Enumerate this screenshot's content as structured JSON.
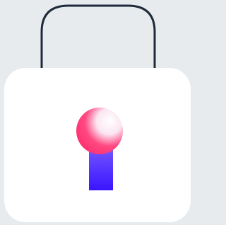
{
  "illustration": {
    "icon": "padlock-icon",
    "colors": {
      "background": "#e7ebee",
      "lock_body": "#ffffff",
      "shackle_stroke": "#1f2a3a",
      "keyhole_pink": "#ff2d6f",
      "keyhole_highlight": "#ffffff",
      "keyhole_blue": "#3a14ff"
    }
  }
}
